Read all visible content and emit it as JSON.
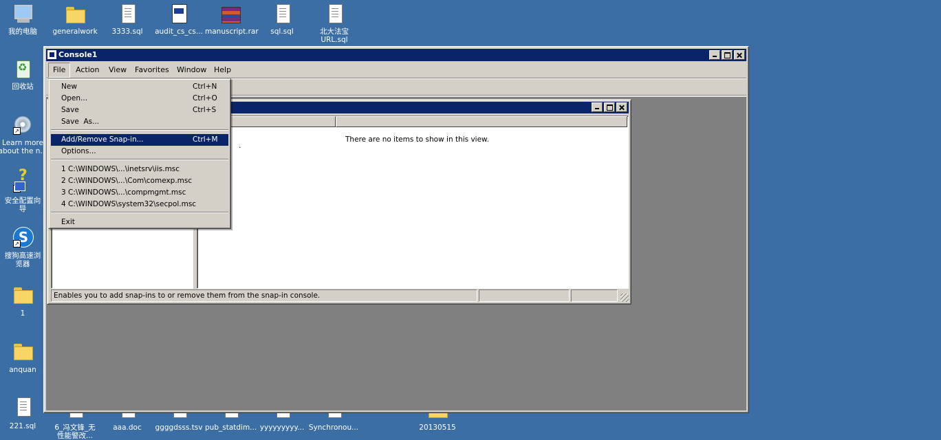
{
  "desktop": {
    "icons_top": [
      {
        "label": "我的电脑",
        "icon": "my-computer-icon"
      },
      {
        "label": "generalwork",
        "icon": "folder-icon"
      },
      {
        "label": "3333.sql",
        "icon": "document-icon"
      },
      {
        "label": "audit_cs_cs...",
        "icon": "app-document-icon"
      },
      {
        "label": "manuscript.rar",
        "icon": "rar-archive-icon"
      },
      {
        "label": "sql.sql",
        "icon": "document-icon"
      },
      {
        "label": "北大法宝 URL.sql",
        "icon": "document-icon"
      }
    ],
    "icons_left": [
      {
        "label": "回收站",
        "icon": "recycle-bin-icon"
      },
      {
        "label": "Learn more about the n...",
        "icon": "cd-icon"
      },
      {
        "label": "安全配置向导",
        "icon": "security-wizard-icon"
      },
      {
        "label": "搜狗高速浏览器",
        "icon": "sogou-browser-icon"
      },
      {
        "label": "1",
        "icon": "folder-icon"
      },
      {
        "label": "anquan",
        "icon": "folder-icon"
      },
      {
        "label": "221.sql",
        "icon": "document-icon"
      }
    ],
    "icons_bottom": [
      {
        "label": "6_冯文锋_无性能警改...",
        "icon": "document-icon"
      },
      {
        "label": "aaa.doc",
        "icon": "document-icon"
      },
      {
        "label": "ggggdsss.tsv",
        "icon": "document-icon"
      },
      {
        "label": "pub_statdim...",
        "icon": "document-icon"
      },
      {
        "label": "yyyyyyyyy...",
        "icon": "document-icon"
      },
      {
        "label": "Synchronou...",
        "icon": "document-icon"
      },
      {
        "label": "20130515",
        "icon": "folder-icon"
      }
    ]
  },
  "console": {
    "title": "Console1",
    "menu": [
      "File",
      "Action",
      "View",
      "Favorites",
      "Window",
      "Help"
    ],
    "file_menu": {
      "items": [
        {
          "label": "New",
          "shortcut": "Ctrl+N"
        },
        {
          "label": "Open...",
          "shortcut": "Ctrl+O"
        },
        {
          "label": "Save",
          "shortcut": "Ctrl+S"
        },
        {
          "label": "Save  As...",
          "shortcut": ""
        },
        {
          "label": "Add/Remove Snap-in...",
          "shortcut": "Ctrl+M"
        },
        {
          "label": "Options...",
          "shortcut": ""
        },
        {
          "label": "1 C:\\WINDOWS\\...\\inetsrv\\iis.msc",
          "shortcut": ""
        },
        {
          "label": "2 C:\\WINDOWS\\...\\Com\\comexp.msc",
          "shortcut": ""
        },
        {
          "label": "3 C:\\WINDOWS\\...\\compmgmt.msc",
          "shortcut": ""
        },
        {
          "label": "4 C:\\WINDOWS\\system32\\secpol.msc",
          "shortcut": ""
        },
        {
          "label": "Exit",
          "shortcut": ""
        }
      ]
    },
    "child": {
      "empty_message": "There are no items to show in this view.",
      "dot": ".",
      "status": "Enables you to add snap-ins to or remove them from the snap-in console."
    }
  }
}
